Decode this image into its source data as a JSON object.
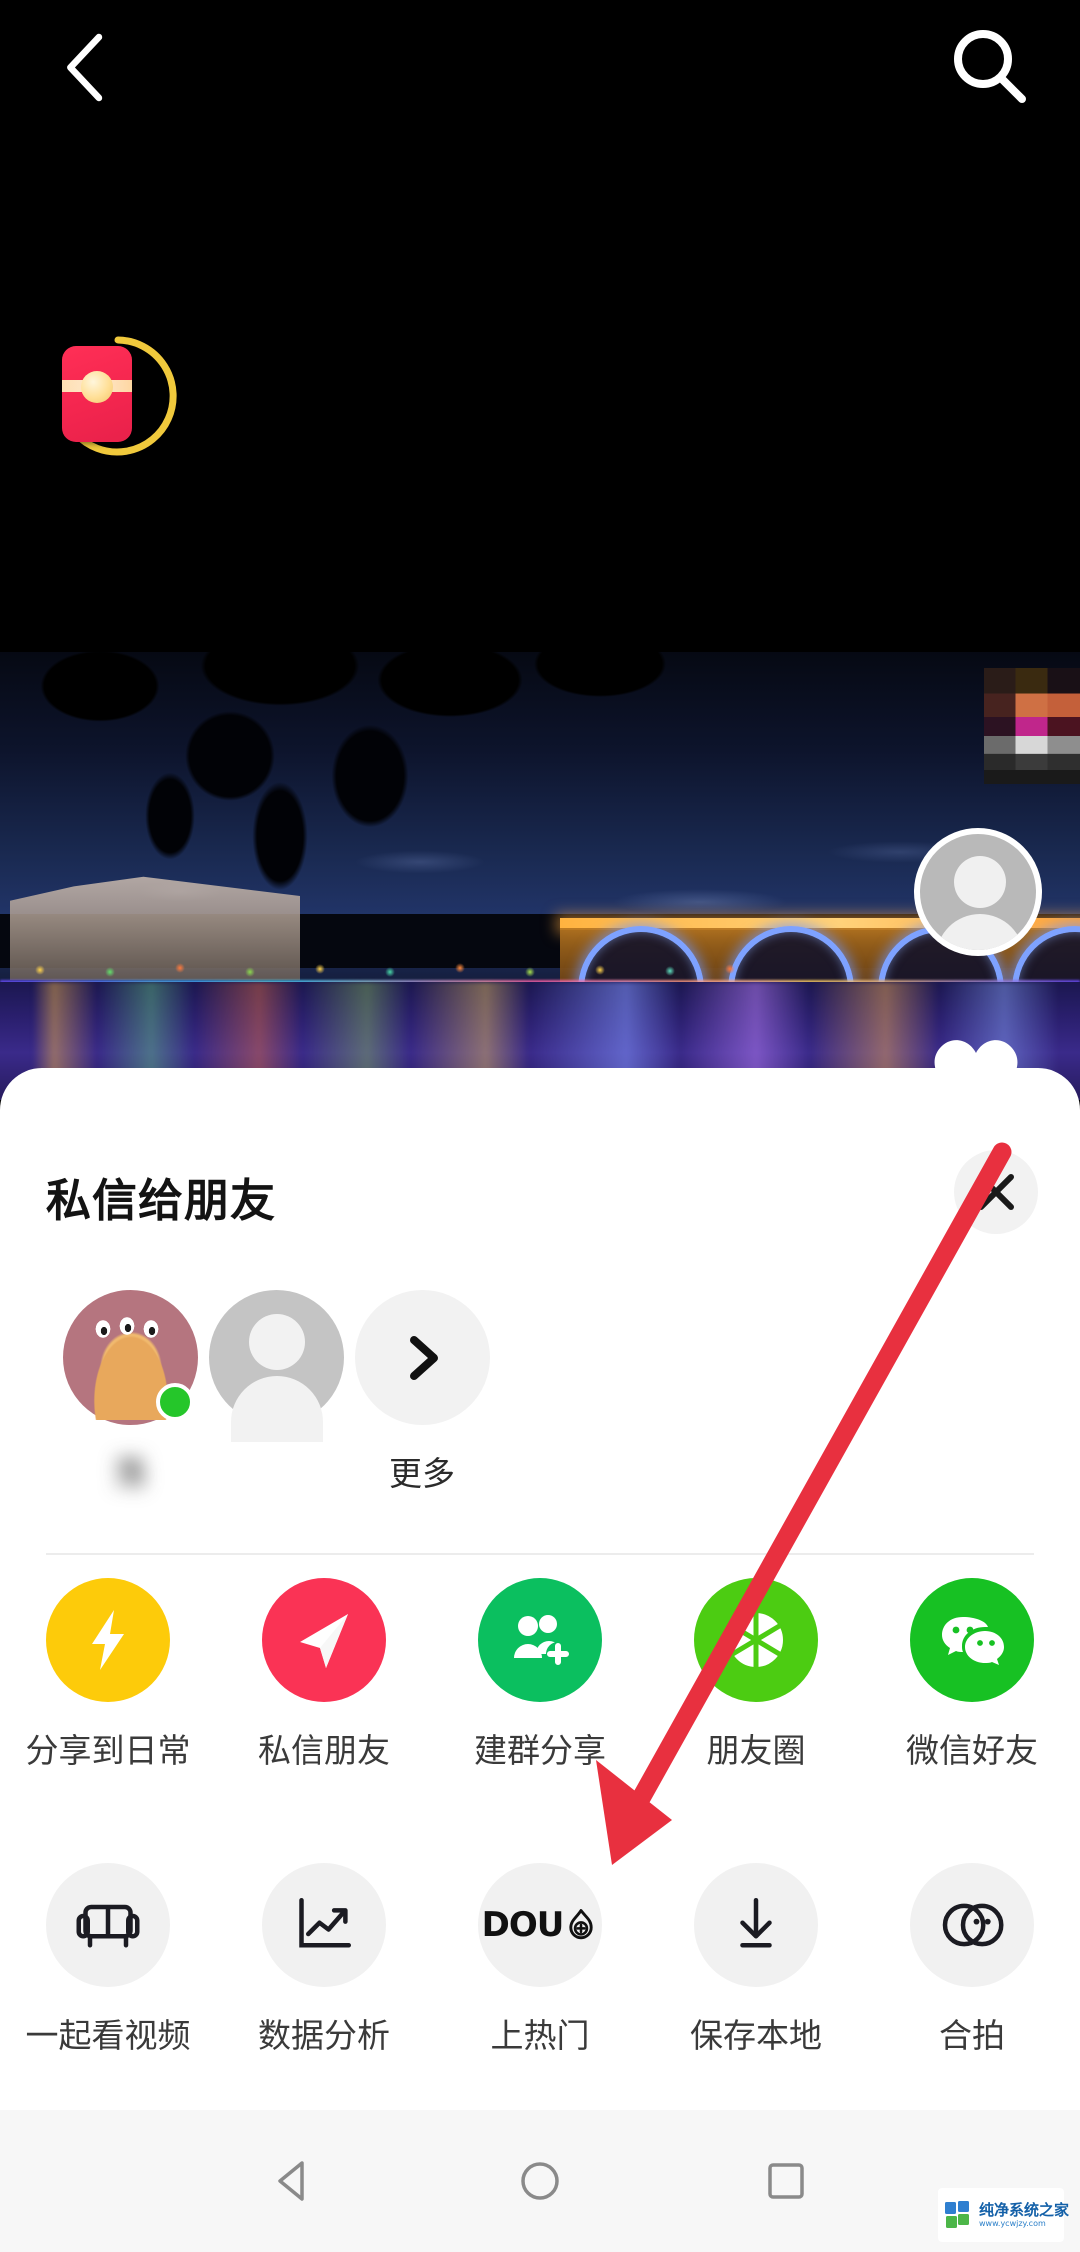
{
  "topbar": {
    "back_icon": "chevron-left-icon",
    "search_icon": "search-icon"
  },
  "overlay": {
    "red_packet_icon": "red-envelope-icon",
    "author_avatar": "default-user-avatar",
    "like_icon": "heart-icon",
    "censor_block": "mosaic-block"
  },
  "sheet": {
    "title": "私信给朋友",
    "close_icon": "close-icon",
    "friends": [
      {
        "name": "荡",
        "blurred": true,
        "avatar": "bird-avatar",
        "online": true
      },
      {
        "name": "",
        "blurred": true,
        "avatar": "default-user-avatar",
        "online": false
      },
      {
        "name": "更多",
        "blurred": false,
        "avatar": "chevron-right-icon",
        "online": false
      }
    ],
    "row1": [
      {
        "label": "分享到日常",
        "icon": "lightning-icon",
        "color": "#fdcb0a"
      },
      {
        "label": "私信朋友",
        "icon": "paper-plane-icon",
        "color": "#fa3355"
      },
      {
        "label": "建群分享",
        "icon": "add-group-icon",
        "color": "#0bbf5f"
      },
      {
        "label": "朋友圈",
        "icon": "moments-shutter-icon",
        "color": "#4ccc12"
      },
      {
        "label": "微信好友",
        "icon": "wechat-icon",
        "color": "#17c123"
      }
    ],
    "row2": [
      {
        "label": "一起看视频",
        "icon": "sofa-icon",
        "color": "#f1f1f1"
      },
      {
        "label": "数据分析",
        "icon": "line-chart-icon",
        "color": "#f1f1f1"
      },
      {
        "label": "上热门",
        "icon": "dou-plus-icon",
        "color": "#f1f1f1",
        "glyph": "DOU"
      },
      {
        "label": "保存本地",
        "icon": "download-icon",
        "color": "#f1f1f1"
      },
      {
        "label": "合拍",
        "icon": "duet-icon",
        "color": "#f1f1f1"
      }
    ]
  },
  "annotation": {
    "arrow_color": "#e8303f",
    "points_to": "上热门"
  },
  "navbar": {
    "back_icon": "nav-back-triangle-icon",
    "home_icon": "nav-home-circle-icon",
    "recents_icon": "nav-recents-square-icon"
  },
  "watermark": {
    "name": "纯净系统之家",
    "url": "www.ycwjzy.com"
  }
}
